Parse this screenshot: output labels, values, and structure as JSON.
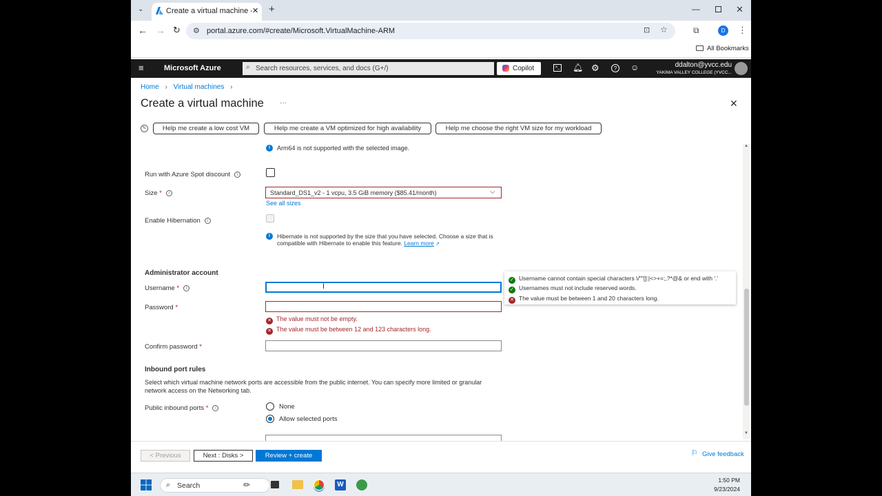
{
  "browser": {
    "tab_title": "Create a virtual machine - Micr",
    "url": "portal.azure.com/#create/Microsoft.VirtualMachine-ARM",
    "bookmarks_label": "All Bookmarks",
    "profile_initial": "D"
  },
  "azure": {
    "brand": "Microsoft Azure",
    "search_placeholder": "Search resources, services, and docs (G+/)",
    "copilot_label": "Copilot",
    "user_email": "ddalton@yvcc.edu",
    "user_org": "YAKIMA VALLEY COLLEGE (YVCC..."
  },
  "breadcrumb": {
    "home": "Home",
    "vms": "Virtual machines"
  },
  "page": {
    "title": "Create a virtual machine",
    "more": "···",
    "helper_buttons": [
      "Help me create a low cost VM",
      "Help me create a VM optimized for high availability",
      "Help me choose the right VM size for my workload"
    ]
  },
  "form": {
    "arm_notice": "Arm64 is not supported with the selected image.",
    "spot_label": "Run with Azure Spot discount",
    "size_label": "Size",
    "size_value": "Standard_DS1_v2 - 1 vcpu, 3.5 GiB memory ($85.41/month)",
    "see_all_sizes": "See all sizes",
    "hibernation_label": "Enable Hibernation",
    "hibernate_notice_line1": "Hibernate is not supported by the size that you have selected. Choose a size that is",
    "hibernate_notice_line2": "compatible with Hibernate to enable this feature.",
    "learn_more": "Learn more",
    "admin_section": "Administrator account",
    "username_label": "Username",
    "password_label": "Password",
    "password_errors": [
      "The value must not be empty.",
      "The value must be between 12 and 123 characters long."
    ],
    "confirm_label": "Confirm password",
    "inbound_section": "Inbound port rules",
    "inbound_desc_line1": "Select which virtual machine network ports are accessible from the public internet. You can specify more limited or granular",
    "inbound_desc_line2": "network access on the Networking tab.",
    "public_ports_label": "Public inbound ports",
    "radio_none": "None",
    "radio_allow": "Allow selected ports",
    "required_mark": "*"
  },
  "tooltip": {
    "rules": [
      {
        "status": "ok",
        "text": "Username cannot contain special characters \\/\"\"[]:|<>+=;,?*@& or end with '.'"
      },
      {
        "status": "ok",
        "text": "Usernames must not include reserved words."
      },
      {
        "status": "error",
        "text": "The value must be between 1 and 20 characters long."
      }
    ]
  },
  "footer": {
    "previous": "< Previous",
    "next": "Next : Disks >",
    "review": "Review + create",
    "feedback": "Give feedback"
  },
  "taskbar": {
    "search": "Search",
    "time": "1:50 PM",
    "date": "9/23/2024"
  },
  "colors": {
    "azure_blue": "#0078d4",
    "error_red": "#a4262c",
    "ok_green": "#107c10",
    "topbar": "#1b1b1b"
  }
}
